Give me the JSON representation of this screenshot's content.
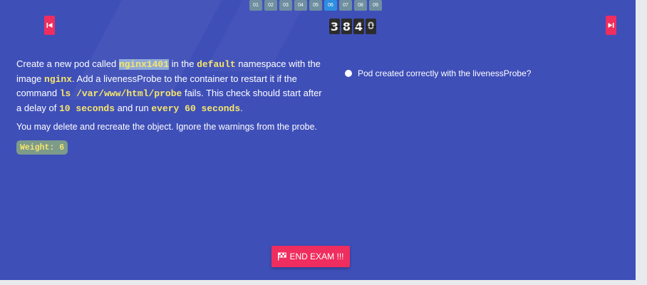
{
  "question_nav": {
    "items": [
      "01",
      "02",
      "03",
      "04",
      "05",
      "06",
      "07",
      "08",
      "09"
    ],
    "active": "06"
  },
  "timer": {
    "digits": [
      "3",
      "8",
      "4",
      "0"
    ]
  },
  "question": {
    "t1": "Create a new pod called ",
    "pod_name": "nginx1401",
    "t2": " in the ",
    "namespace": "default",
    "t3": " namespace with the image ",
    "image": "nginx",
    "t4": ". Add a livenessProbe to the container to restart it if the command ",
    "command": "ls /var/www/html/probe",
    "t5": " fails. This check should start after a delay of ",
    "delay": "10 seconds",
    "t6": " and run ",
    "period": "every 60 seconds",
    "t7": "."
  },
  "note": "You may delete and recreate the object. Ignore the warnings from the probe.",
  "weight": "Weight: 6",
  "checks": [
    "Pod created correctly with the livenessProbe?"
  ],
  "end_exam_label": "END EXAM !!!",
  "colors": {
    "background": "#3f4fb8",
    "accent": "#ef2d5e",
    "code": "#f6e66b"
  }
}
